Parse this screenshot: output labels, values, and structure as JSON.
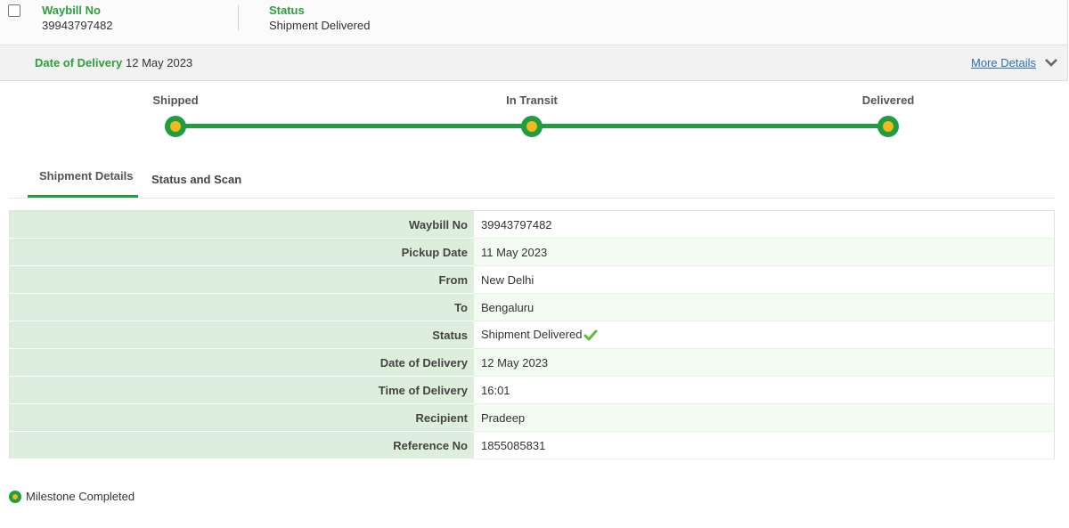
{
  "top": {
    "waybill_label": "Waybill No",
    "waybill_value": "39943797482",
    "status_label": "Status",
    "status_value": "Shipment Delivered"
  },
  "delivery_bar": {
    "label": "Date of Delivery",
    "value": "12 May 2023",
    "more_link": "More Details",
    "chevron_icon": "chevron-down-icon"
  },
  "progress": {
    "steps": [
      "Shipped",
      "In Transit",
      "Delivered"
    ],
    "completed_steps": 3,
    "colors": {
      "track": "#1e9e3e",
      "milestone_center": "#f3b81c"
    }
  },
  "tabs": {
    "items": [
      "Shipment Details",
      "Status and Scan"
    ],
    "active": "Shipment Details"
  },
  "details": {
    "rows": [
      {
        "key": "Waybill No",
        "value": "39943797482"
      },
      {
        "key": "Pickup Date",
        "value": "11 May 2023"
      },
      {
        "key": "From",
        "value": "New Delhi"
      },
      {
        "key": "To",
        "value": "Bengaluru"
      },
      {
        "key": "Status",
        "value": "Shipment Delivered"
      },
      {
        "key": "Date of Delivery",
        "value": "12 May 2023"
      },
      {
        "key": "Time of Delivery",
        "value": "16:01"
      },
      {
        "key": "Recipient",
        "value": "Pradeep"
      },
      {
        "key": "Reference No",
        "value": "1855085831"
      }
    ],
    "status_icon": "checkmark-icon"
  },
  "legend": {
    "label": "Milestone Completed"
  }
}
